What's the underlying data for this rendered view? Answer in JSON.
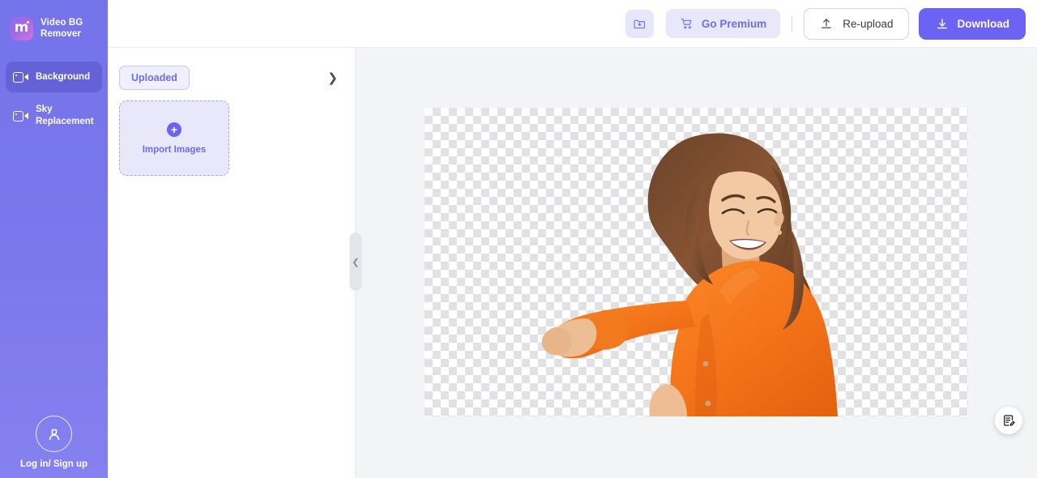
{
  "app": {
    "brand_name": "Video BG Remover",
    "brand_logo_letter": "m"
  },
  "sidebar": {
    "items": [
      {
        "label": "Background",
        "icon": "video-camera-icon",
        "active": true
      },
      {
        "label": "Sky Replacement",
        "icon": "video-camera-icon",
        "active": false
      }
    ],
    "account": {
      "label": "Log in/ Sign up",
      "icon": "user-avatar-icon"
    }
  },
  "toolbar": {
    "save_to_folder_icon": "folder-download-icon",
    "premium_label": "Go Premium",
    "premium_icon": "shopping-cart-icon",
    "reupload_label": "Re-upload",
    "reupload_icon": "upload-icon",
    "download_label": "Download",
    "download_icon": "download-icon"
  },
  "panel": {
    "tab_label": "Uploaded",
    "expand_icon": "chevron-right-icon",
    "import_label": "Import Images",
    "import_icon": "plus-circle-icon",
    "collapse_icon": "chevron-left-icon"
  },
  "canvas": {
    "transparency_pattern": "checkerboard",
    "subject_description": "woman-in-orange-shirt",
    "feedback_icon": "feedback-note-icon"
  },
  "colors": {
    "brand_purple": "#6c63f5",
    "sidebar_purple": "#7573e9",
    "accent_light": "#e9e8fb",
    "workspace_bg": "#f3f4f6",
    "shirt_orange": "#f4741a"
  }
}
